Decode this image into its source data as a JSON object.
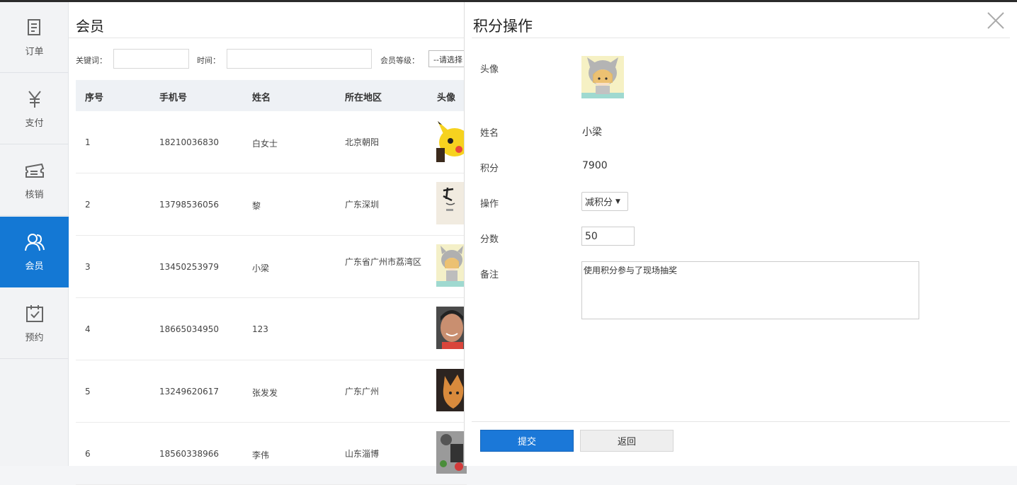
{
  "sidebar": {
    "items": [
      {
        "label": "订单",
        "icon": "document-icon"
      },
      {
        "label": "支付",
        "icon": "yen-icon"
      },
      {
        "label": "核销",
        "icon": "ticket-icon"
      },
      {
        "label": "会员",
        "icon": "users-icon",
        "active": true
      },
      {
        "label": "预约",
        "icon": "calendar-check-icon"
      }
    ],
    "active_color": "#1478d4"
  },
  "page": {
    "title": "会员",
    "filters": {
      "keyword_label": "关键词：",
      "time_label": "时间：",
      "level_label": "会员等级：",
      "level_select": "--请选择"
    }
  },
  "table": {
    "columns": [
      "序号",
      "手机号",
      "姓名",
      "所在地区",
      "头像"
    ],
    "rows": [
      {
        "no": "1",
        "phone": "18210036830",
        "name": "白女士",
        "area": "北京朝阳"
      },
      {
        "no": "2",
        "phone": "13798536056",
        "name": "黎",
        "area": "广东深圳"
      },
      {
        "no": "3",
        "phone": "13450253979",
        "name": "小梁",
        "area": "广东省广州市荔湾区"
      },
      {
        "no": "4",
        "phone": "18665034950",
        "name": "123",
        "area": ""
      },
      {
        "no": "5",
        "phone": "13249620617",
        "name": "张发发",
        "area": "广东广州"
      },
      {
        "no": "6",
        "phone": "18560338966",
        "name": "李伟",
        "area": "山东淄博"
      }
    ]
  },
  "modal": {
    "title": "积分操作",
    "fields": {
      "avatar_label": "头像",
      "name_label": "姓名",
      "name_value": "小梁",
      "points_label": "积分",
      "points_value": "7900",
      "operation_label": "操作",
      "operation_value": "减积分",
      "score_label": "分数",
      "score_value": "50",
      "remark_label": "备注",
      "remark_value": "使用积分参与了现场抽奖"
    },
    "submit_label": "提交",
    "back_label": "返回",
    "submit_color": "#1b78d8"
  }
}
